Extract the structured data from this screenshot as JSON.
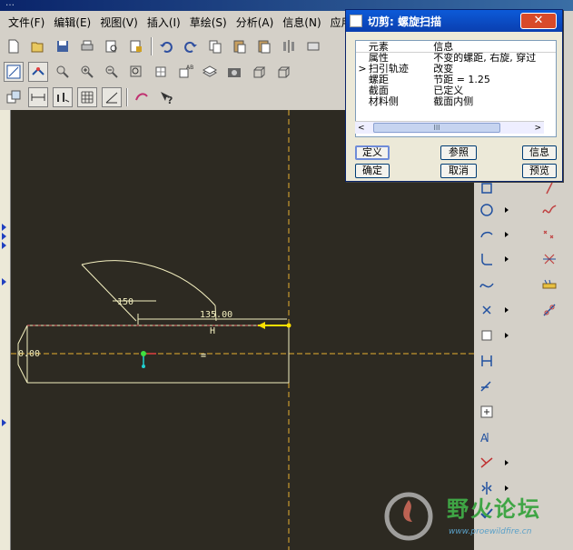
{
  "titlebar": {
    "text": "…"
  },
  "menu": [
    "文件(F)",
    "编辑(E)",
    "视图(V)",
    "插入(I)",
    "草绘(S)",
    "分析(A)",
    "信息(N)",
    "应用程"
  ],
  "toolbar1": [
    "new-icon",
    "open-icon",
    "save-icon",
    "print-icon",
    "find-icon",
    "lock-icon",
    "undo-icon",
    "redo-icon",
    "copy-icon",
    "paste-icon",
    "paste-special-icon",
    "mirror-icon",
    "more-icon"
  ],
  "toolbar2": [
    "sketch-display-icon",
    "constraint-icon",
    "zoom-fit-icon",
    "zoom-in-icon",
    "zoom-out-icon",
    "zoom-box-icon",
    "refit-icon",
    "layer-icon",
    "named-view-icon",
    "camera-icon",
    "box-view-icon",
    "box-view2-icon"
  ],
  "toolbar3": [
    "sketch-icon",
    "dim-display-icon",
    "constraint-display-icon",
    "grid-display-icon",
    "vertex-display-icon",
    "spin-icon",
    "help-icon"
  ],
  "dialog": {
    "title": "切剪: 螺旋扫描",
    "close": "✕",
    "columns": [
      "元素",
      "信息"
    ],
    "rows": [
      {
        "mark": "",
        "element": "属性",
        "info": "不变的螺距, 右旋, 穿过"
      },
      {
        "mark": ">",
        "element": "扫引轨迹",
        "info": "改变"
      },
      {
        "mark": "",
        "element": "螺距",
        "info": "节距 = 1.25"
      },
      {
        "mark": "",
        "element": "截面",
        "info": "已定义"
      },
      {
        "mark": "",
        "element": "材料侧",
        "info": "截面内侧"
      }
    ],
    "scroll_left": "<",
    "scroll_right": ">",
    "scroll_thumb": "III",
    "buttons": {
      "define": "定义",
      "reference": "参照",
      "info": "信息",
      "ok": "确定",
      "cancel": "取消",
      "preview": "预览"
    }
  },
  "sketch": {
    "dim_150": "150",
    "dim_135": "135.00",
    "dim_h": "H",
    "dim_0": "0.00",
    "equal_mark": "="
  },
  "watermark": {
    "title": "野火论坛",
    "url": "www.proewildfire.cn"
  },
  "colors": {
    "canvas": "#2d2a22",
    "sketch": "#f4f0c0",
    "centerline": "#e8b030",
    "accent_yellow": "#ffe000"
  }
}
